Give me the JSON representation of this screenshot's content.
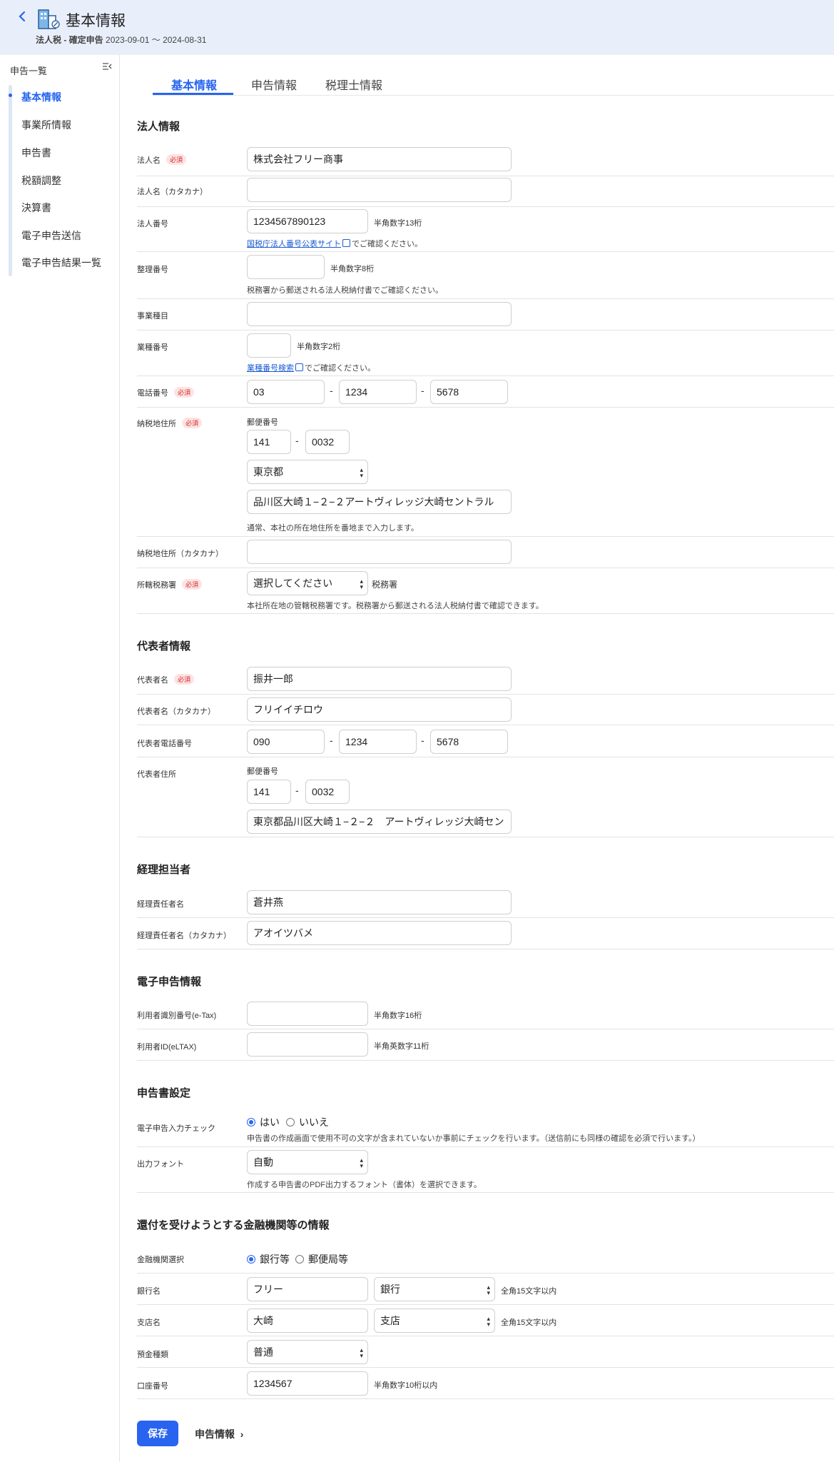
{
  "header": {
    "back_icon": "chevron-left-icon",
    "building_icon": "building-icon",
    "title": "基本情報",
    "subtitle_bold": "法人税 - 確定申告",
    "subtitle_period": "2023-09-01 〜 2024-08-31"
  },
  "sidebar": {
    "heading": "申告一覧",
    "collapse_icon": "sidebar-collapse-icon",
    "items": [
      {
        "label": "基本情報",
        "active": true
      },
      {
        "label": "事業所情報"
      },
      {
        "label": "申告書"
      },
      {
        "label": "税額調整"
      },
      {
        "label": "決算書"
      },
      {
        "label": "電子申告送信"
      },
      {
        "label": "電子申告結果一覧"
      }
    ]
  },
  "tabs": [
    "基本情報",
    "申告情報",
    "税理士情報"
  ],
  "required_badge": "必須",
  "corp": {
    "section_title": "法人情報",
    "name_label": "法人名",
    "name_value": "株式会社フリー商事",
    "kana_label": "法人名（カタカナ）",
    "kana_value": "",
    "number_label": "法人番号",
    "number_value": "1234567890123",
    "number_hint": "半角数字13桁",
    "number_link": "国税庁法人番号公表サイト",
    "number_link_suffix": "でご確認ください。",
    "ref_label": "整理番号",
    "ref_value": "",
    "ref_hint": "半角数字8桁",
    "ref_note": "税務署から郵送される法人税納付書でご確認ください。",
    "business_label": "事業種目",
    "business_value": "",
    "industry_label": "業種番号",
    "industry_value": "",
    "industry_hint": "半角数字2桁",
    "industry_link": "業種番号検索",
    "industry_link_suffix": "でご確認ください。",
    "phone_label": "電話番号",
    "phone": [
      "03",
      "1234",
      "5678"
    ],
    "addr_label": "納税地住所",
    "postal_label": "郵便番号",
    "postal": [
      "141",
      "0032"
    ],
    "prefecture": "東京都",
    "address": "品川区大崎１−２−２アートヴィレッジ大崎セントラル",
    "address_note": "通常、本社の所在地住所を番地まで入力します。",
    "addr_kana_label": "納税地住所（カタカナ）",
    "addr_kana_value": "",
    "office_label": "所轄税務署",
    "office_value": "選択してください",
    "office_suffix": "税務署",
    "office_note": "本社所在地の管轄税務署です。税務署から郵送される法人税納付書で確認できます。",
    "dash": "-"
  },
  "rep": {
    "section_title": "代表者情報",
    "name_label": "代表者名",
    "name_value": "振井一郎",
    "kana_label": "代表者名（カタカナ）",
    "kana_value": "フリイイチロウ",
    "phone_label": "代表者電話番号",
    "phone": [
      "090",
      "1234",
      "5678"
    ],
    "addr_label": "代表者住所",
    "postal_label": "郵便番号",
    "postal": [
      "141",
      "0032"
    ],
    "address": "東京都品川区大崎１−２−２　アートヴィレッジ大崎セン"
  },
  "acct": {
    "section_title": "経理担当者",
    "name_label": "経理責任者名",
    "name_value": "蒼井燕",
    "kana_label": "経理責任者名（カタカナ）",
    "kana_value": "アオイツバメ"
  },
  "etax": {
    "section_title": "電子申告情報",
    "etax_label": "利用者識別番号(e-Tax)",
    "etax_value": "",
    "etax_hint": "半角数字16桁",
    "eltax_label": "利用者ID(eLTAX)",
    "eltax_value": "",
    "eltax_hint": "半角英数字11桁"
  },
  "form": {
    "section_title": "申告書設定",
    "check_label": "電子申告入力チェック",
    "yes": "はい",
    "no": "いいえ",
    "check_note": "申告書の作成画面で使用不可の文字が含まれていないか事前にチェックを行います。（送信前にも同様の確認を必須で行います。）",
    "font_label": "出力フォント",
    "font_value": "自動",
    "font_note": "作成する申告書のPDF出力するフォント（書体）を選択できます。"
  },
  "bank": {
    "section_title": "還付を受けようとする金融機関等の情報",
    "select_label": "金融機関選択",
    "opt_bank": "銀行等",
    "opt_post": "郵便局等",
    "bank_label": "銀行名",
    "bank_value": "フリー",
    "bank_type": "銀行",
    "bank_hint": "全角15文字以内",
    "branch_label": "支店名",
    "branch_value": "大崎",
    "branch_type": "支店",
    "branch_hint": "全角15文字以内",
    "deposit_label": "預金種類",
    "deposit_value": "普通",
    "account_label": "口座番号",
    "account_value": "1234567",
    "account_hint": "半角数字10桁以内"
  },
  "footer": {
    "save": "保存",
    "next": "申告情報"
  }
}
